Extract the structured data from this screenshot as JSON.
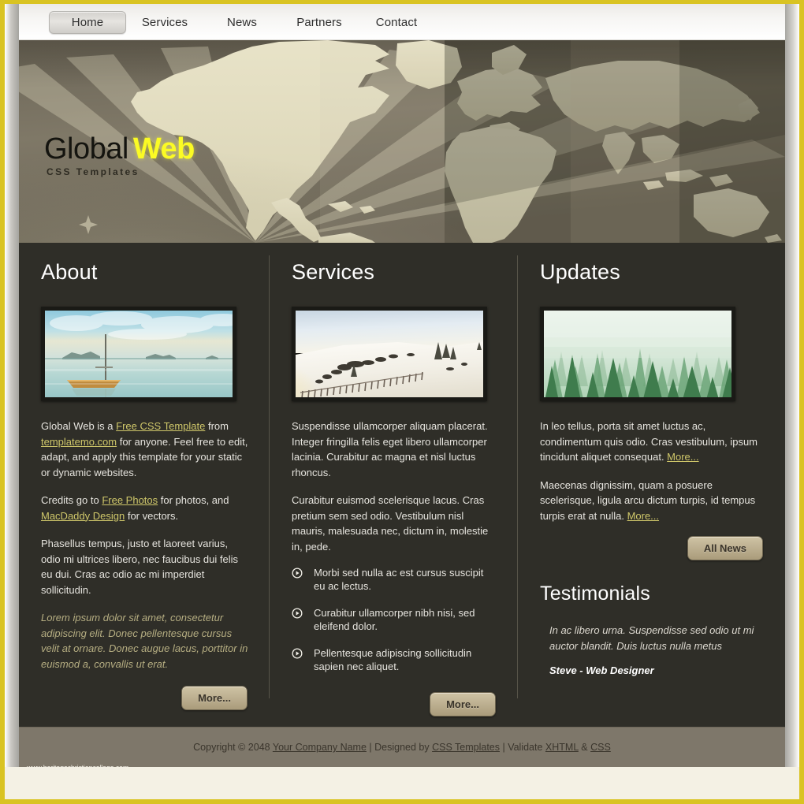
{
  "nav": {
    "items": [
      {
        "label": "Home",
        "active": true
      },
      {
        "label": "Services",
        "active": false
      },
      {
        "label": "News",
        "active": false
      },
      {
        "label": "Partners",
        "active": false
      },
      {
        "label": "Contact",
        "active": false
      }
    ]
  },
  "banner": {
    "logo_primary": "Global",
    "logo_accent": "Web",
    "logo_subtitle": "CSS Templates",
    "accent_color": "#fbfb24",
    "background_description": "world-map-sepia"
  },
  "about": {
    "heading": "About",
    "image_alt": "boat-on-calm-water",
    "p1_a": "Global Web is a ",
    "p1_link1": "Free CSS Template",
    "p1_b": " from ",
    "p1_link2": "templatemo.com",
    "p1_c": " for anyone. Feel free to edit, adapt, and apply this template for your static or dynamic websites.",
    "p2_a": "Credits go to ",
    "p2_link1": "Free Photos",
    "p2_b": " for photos, and ",
    "p2_link2": "MacDaddy Design",
    "p2_c": " for vectors.",
    "p3": "Phasellus tempus, justo et laoreet varius, odio mi ultrices libero, nec faucibus dui felis eu dui. Cras ac odio ac mi imperdiet sollicitudin.",
    "p4_italic": "Lorem ipsum dolor sit amet, consectetur adipiscing elit. Donec pellentesque cursus velit at ornare. Donec augue lacus, porttitor in euismod a, convallis ut erat.",
    "more_label": "More..."
  },
  "services": {
    "heading": "Services",
    "image_alt": "snowy-landscape-with-fence",
    "p1": "Suspendisse ullamcorper aliquam placerat. Integer fringilla felis eget libero ullamcorper lacinia. Curabitur ac magna et nisl luctus rhoncus.",
    "p2": "Curabitur euismod scelerisque lacus. Cras pretium sem sed odio. Vestibulum nisl mauris, malesuada nec, dictum in, molestie in, pede.",
    "bullets": [
      "Morbi sed nulla ac est cursus suscipit eu ac lectus.",
      "Curabitur ullamcorper nibh nisi, sed eleifend dolor.",
      "Pellentesque adipiscing sollicitudin sapien nec aliquet."
    ],
    "more_label": "More..."
  },
  "updates": {
    "heading": "Updates",
    "image_alt": "misty-pine-forest",
    "p1_text": "In leo tellus, porta sit amet luctus ac, condimentum quis odio. Cras vestibulum, ipsum tincidunt aliquet consequat. ",
    "p1_more": "More...",
    "p2_text": "Maecenas dignissim, quam a posuere scelerisque, ligula arcu dictum turpis, id tempus turpis erat at nulla. ",
    "p2_more": "More...",
    "all_news_label": "All News"
  },
  "testimonials": {
    "heading": "Testimonials",
    "quote": "In ac libero urna. Suspendisse sed odio ut mi auctor blandit. Duis luctus nulla metus",
    "author": "Steve - Web Designer"
  },
  "footer": {
    "copyright_prefix": "Copyright © 2048 ",
    "company_link": "Your Company Name",
    "designed_by_prefix": " | Designed by ",
    "designer_link": "CSS Templates",
    "validate_prefix": " | Validate ",
    "xhtml_link": "XHTML",
    "amp": " & ",
    "css_link": "CSS",
    "watermark": "www.heritagechristiancollege.com"
  }
}
